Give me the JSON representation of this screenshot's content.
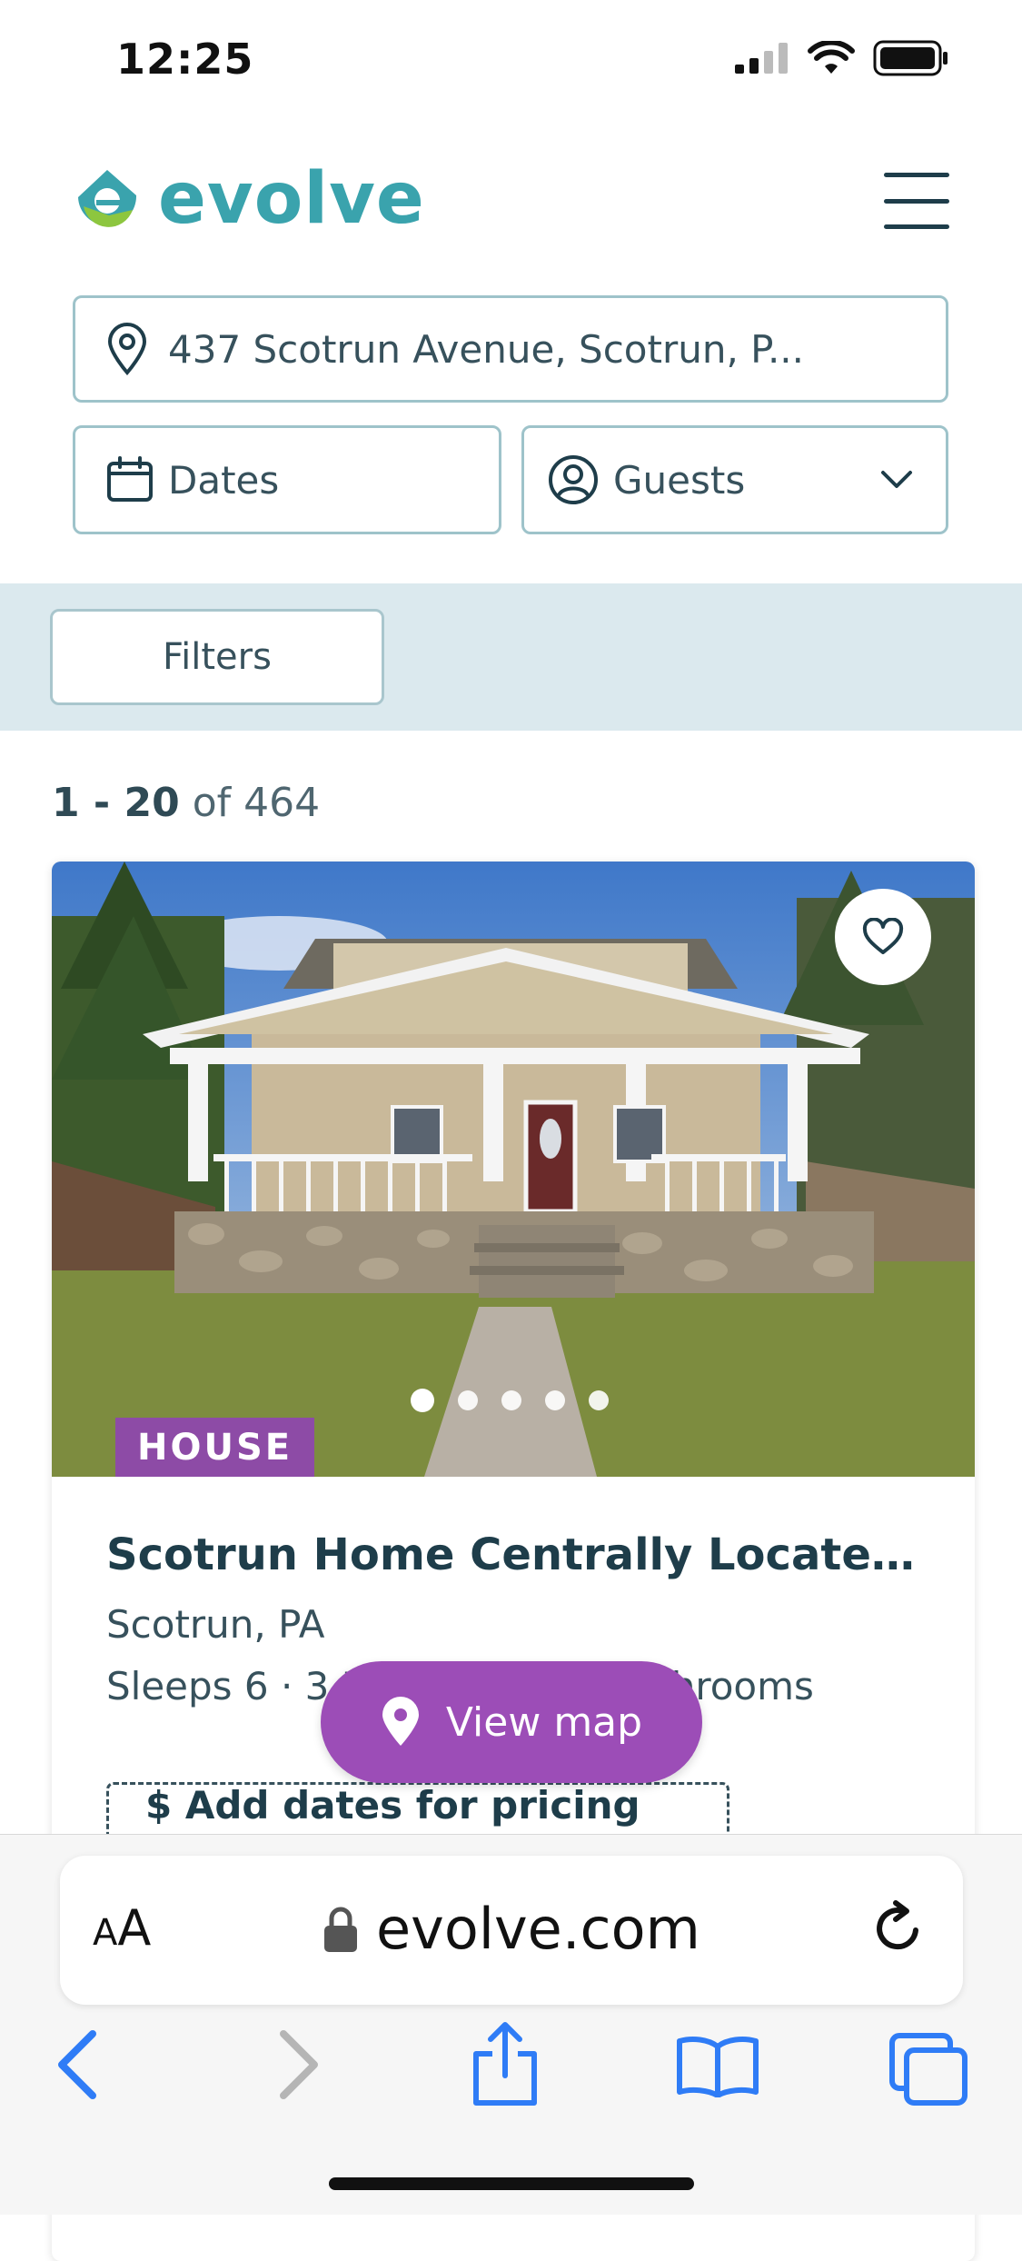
{
  "status": {
    "time": "12:25"
  },
  "brand": {
    "name": "evolve"
  },
  "search": {
    "location": "437 Scotrun Avenue, Scotrun, P...",
    "dates_placeholder": "Dates",
    "guests_placeholder": "Guests"
  },
  "filters": {
    "label": "Filters"
  },
  "results": {
    "range": "1 - 20",
    "of_text": " of 464"
  },
  "listing": {
    "badge": "HOUSE",
    "title": "Scotrun Home Centrally Located t...",
    "location": "Scotrun, PA",
    "specs": "Sleeps 6 · 3 Bedrooms · 2 Bathrooms",
    "add_dates": "$ Add dates for pricing info",
    "photo_count": 5,
    "active_photo": 1
  },
  "map_button": {
    "label": "View map"
  },
  "browser": {
    "text_size_label": "AA",
    "url": "evolve.com"
  },
  "colors": {
    "brand_teal": "#3aa3ad",
    "brand_green": "#8dc63f",
    "accent_purple": "#9c4db7",
    "badge_purple": "#8d4ba6",
    "ios_blue": "#2f7cf6"
  }
}
